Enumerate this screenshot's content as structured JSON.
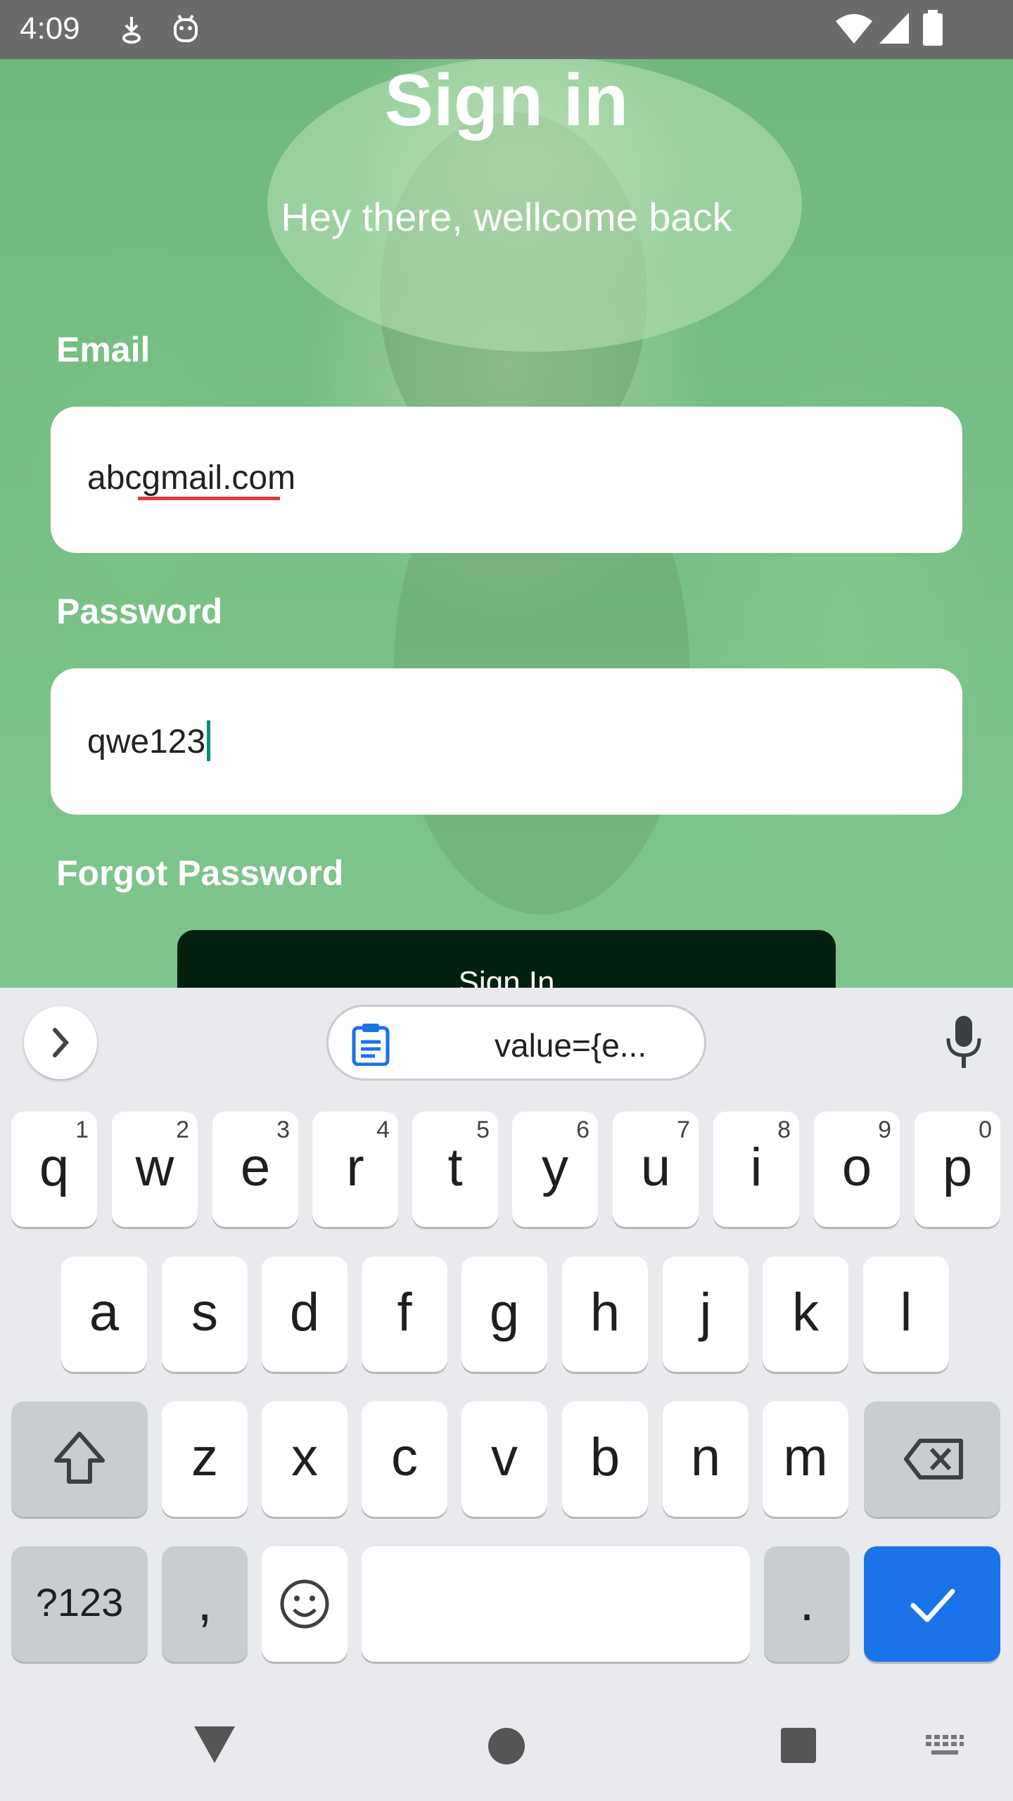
{
  "status_bar": {
    "time": "4:09"
  },
  "screen": {
    "title": "Sign in",
    "subtitle": "Hey there, wellcome back",
    "email_label": "Email",
    "email_value": "abcgmail.com",
    "password_label": "Password",
    "password_value": "qwe123",
    "forgot_password": "Forgot Password",
    "sign_in_button": "Sign In"
  },
  "keyboard": {
    "clipboard_suggestion": "value={e...",
    "row1": [
      {
        "k": "q",
        "n": "1"
      },
      {
        "k": "w",
        "n": "2"
      },
      {
        "k": "e",
        "n": "3"
      },
      {
        "k": "r",
        "n": "4"
      },
      {
        "k": "t",
        "n": "5"
      },
      {
        "k": "y",
        "n": "6"
      },
      {
        "k": "u",
        "n": "7"
      },
      {
        "k": "i",
        "n": "8"
      },
      {
        "k": "o",
        "n": "9"
      },
      {
        "k": "p",
        "n": "0"
      }
    ],
    "row2": [
      "a",
      "s",
      "d",
      "f",
      "g",
      "h",
      "j",
      "k",
      "l"
    ],
    "row3": [
      "z",
      "x",
      "c",
      "v",
      "b",
      "n",
      "m"
    ],
    "symbols_key": "?123",
    "comma_key": ",",
    "period_key": "."
  },
  "colors": {
    "overlay": "#6ec882",
    "field_bg": "#ffffff",
    "button": "#02200f",
    "accent": "#1a73e8"
  }
}
